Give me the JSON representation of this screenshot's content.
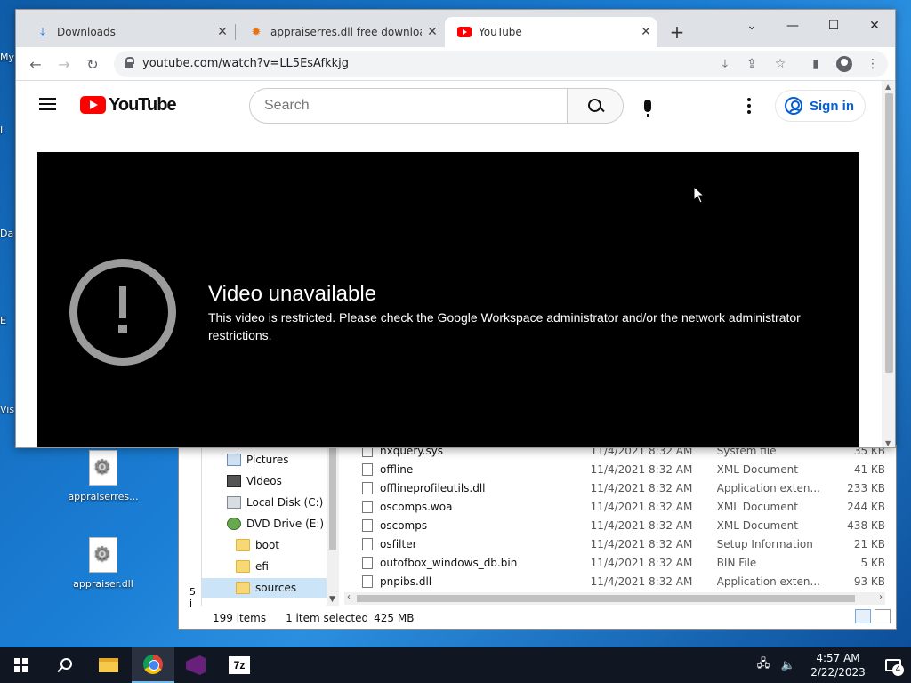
{
  "desktop": {
    "edge_labels": [
      "My",
      "I",
      "Da",
      "E",
      "Vis"
    ],
    "icons": [
      {
        "label": "appraiserres...",
        "icon": "settings-file-icon"
      },
      {
        "label": "appraiser.dll",
        "icon": "settings-file-icon"
      }
    ]
  },
  "explorer": {
    "left_edge_text": "5 i",
    "nav_items": [
      {
        "label": "Pictures",
        "icon": "pictures-icon"
      },
      {
        "label": "Videos",
        "icon": "videos-icon"
      },
      {
        "label": "Local Disk (C:)",
        "icon": "disk-icon"
      },
      {
        "label": "DVD Drive (E:) C(",
        "icon": "dvd-icon"
      },
      {
        "label": "boot",
        "icon": "folder-icon"
      },
      {
        "label": "efi",
        "icon": "folder-icon"
      },
      {
        "label": "sources",
        "icon": "folder-icon",
        "selected": true
      }
    ],
    "files": [
      {
        "name": "nxquery.sys",
        "date": "11/4/2021 8:32 AM",
        "type": "System file",
        "size": "35 KB"
      },
      {
        "name": "offline",
        "date": "11/4/2021 8:32 AM",
        "type": "XML Document",
        "size": "41 KB"
      },
      {
        "name": "offlineprofileutils.dll",
        "date": "11/4/2021 8:32 AM",
        "type": "Application exten...",
        "size": "233 KB"
      },
      {
        "name": "oscomps.woa",
        "date": "11/4/2021 8:32 AM",
        "type": "XML Document",
        "size": "244 KB"
      },
      {
        "name": "oscomps",
        "date": "11/4/2021 8:32 AM",
        "type": "XML Document",
        "size": "438 KB"
      },
      {
        "name": "osfilter",
        "date": "11/4/2021 8:32 AM",
        "type": "Setup Information",
        "size": "21 KB"
      },
      {
        "name": "outofbox_windows_db.bin",
        "date": "11/4/2021 8:32 AM",
        "type": "BIN File",
        "size": "5 KB"
      },
      {
        "name": "pnpibs.dll",
        "date": "11/4/2021 8:32 AM",
        "type": "Application exten...",
        "size": "93 KB"
      }
    ],
    "status": {
      "item_count": "199 items",
      "selected": "1 item selected",
      "selected_size": "425 MB"
    }
  },
  "chrome": {
    "tabs": [
      {
        "title": "Downloads",
        "icon": "download-icon",
        "active": false
      },
      {
        "title": "appraiserres.dll free download | ...",
        "icon": "dll-site-icon",
        "active": false
      },
      {
        "title": "YouTube",
        "icon": "youtube-icon",
        "active": true
      }
    ],
    "new_tab": "+",
    "url": "youtube.com/watch?v=LL5EsAfkkjg"
  },
  "youtube": {
    "logo_text": "YouTube",
    "search_placeholder": "Search",
    "sign_in_label": "Sign in",
    "error_title": "Video unavailable",
    "error_message": "This video is restricted. Please check the Google Workspace administrator and/or the network administrator restrictions."
  },
  "taskbar": {
    "time": "4:57 AM",
    "date": "2/22/2023",
    "notification_count": "4",
    "sevenzip_label": "7z",
    "pinned": [
      "start-button",
      "search-button",
      "file-explorer",
      "chrome",
      "visual-studio",
      "7-zip"
    ]
  },
  "colors": {
    "youtube_red": "#ff0000",
    "link_blue": "#065fd4",
    "player_bg": "#000000",
    "taskbar_bg": "#101723"
  }
}
